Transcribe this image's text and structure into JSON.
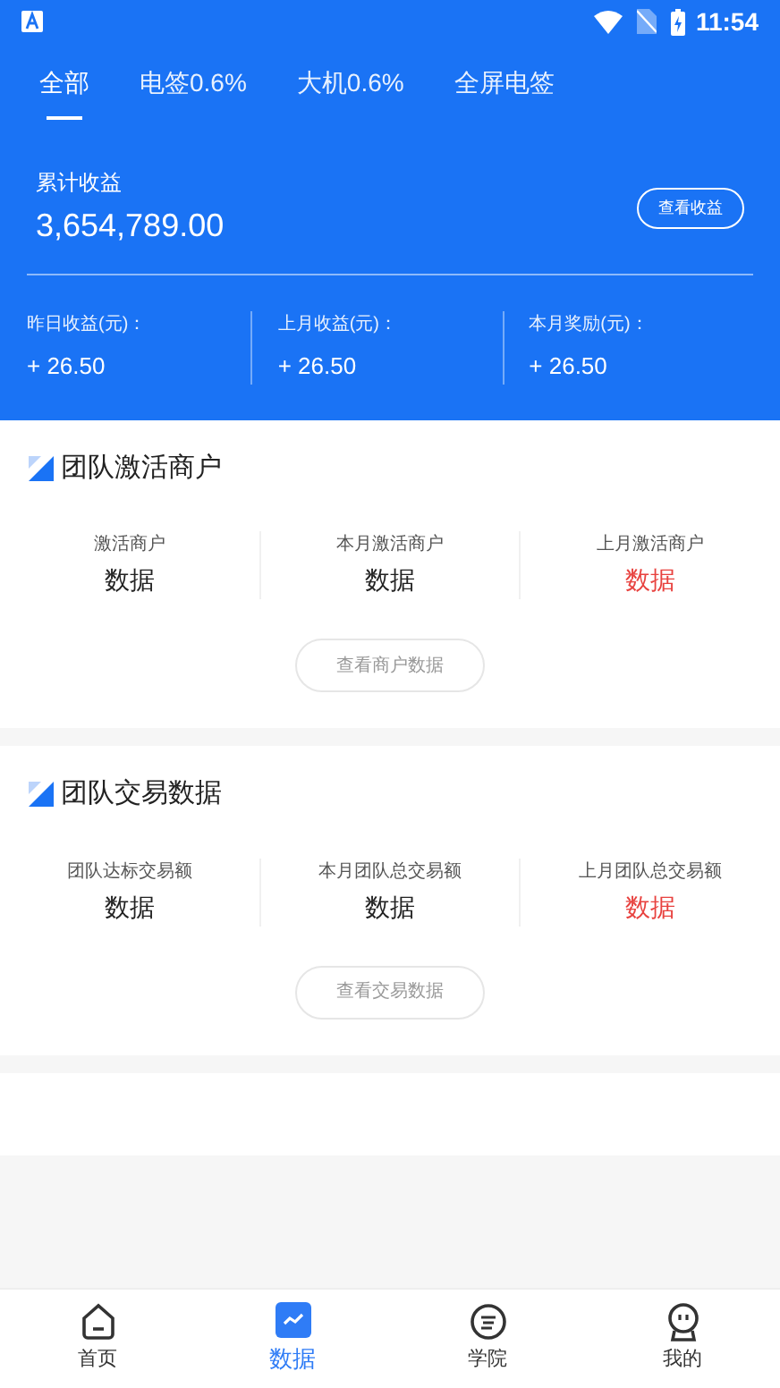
{
  "status_bar": {
    "time": "11:54"
  },
  "tabs": [
    {
      "label": "全部",
      "selected": true
    },
    {
      "label": "电签0.6%",
      "selected": false
    },
    {
      "label": "大机0.6%",
      "selected": false
    },
    {
      "label": "全屏电签",
      "selected": false
    }
  ],
  "earnings": {
    "label": "累计收益",
    "amount": "3,654,789.00",
    "button": "查看收益",
    "stats": [
      {
        "label": "昨日收益(元)：",
        "value": "+ 26.50"
      },
      {
        "label": "上月收益(元)：",
        "value": "+ 26.50"
      },
      {
        "label": "本月奖励(元)：",
        "value": "+ 26.50"
      }
    ]
  },
  "sections": [
    {
      "title": "团队激活商户",
      "button": "查看商户数据",
      "metrics": [
        {
          "label": "激活商户",
          "value": "数据",
          "highlight": false
        },
        {
          "label": "本月激活商户",
          "value": "数据",
          "highlight": false
        },
        {
          "label": "上月激活商户",
          "value": "数据",
          "highlight": true
        }
      ]
    },
    {
      "title": "团队交易数据",
      "button": "查看交易数据",
      "metrics": [
        {
          "label": "团队达标交易额",
          "value": "数据",
          "highlight": false
        },
        {
          "label": "本月团队总交易额",
          "value": "数据",
          "highlight": false
        },
        {
          "label": "上月团队总交易额",
          "value": "数据",
          "highlight": true
        }
      ]
    }
  ],
  "bottom_nav": [
    {
      "label": "首页",
      "kind": "home",
      "selected": false
    },
    {
      "label": "数据",
      "kind": "data",
      "selected": true
    },
    {
      "label": "学院",
      "kind": "academy",
      "selected": false
    },
    {
      "label": "我的",
      "kind": "profile",
      "selected": false
    }
  ]
}
